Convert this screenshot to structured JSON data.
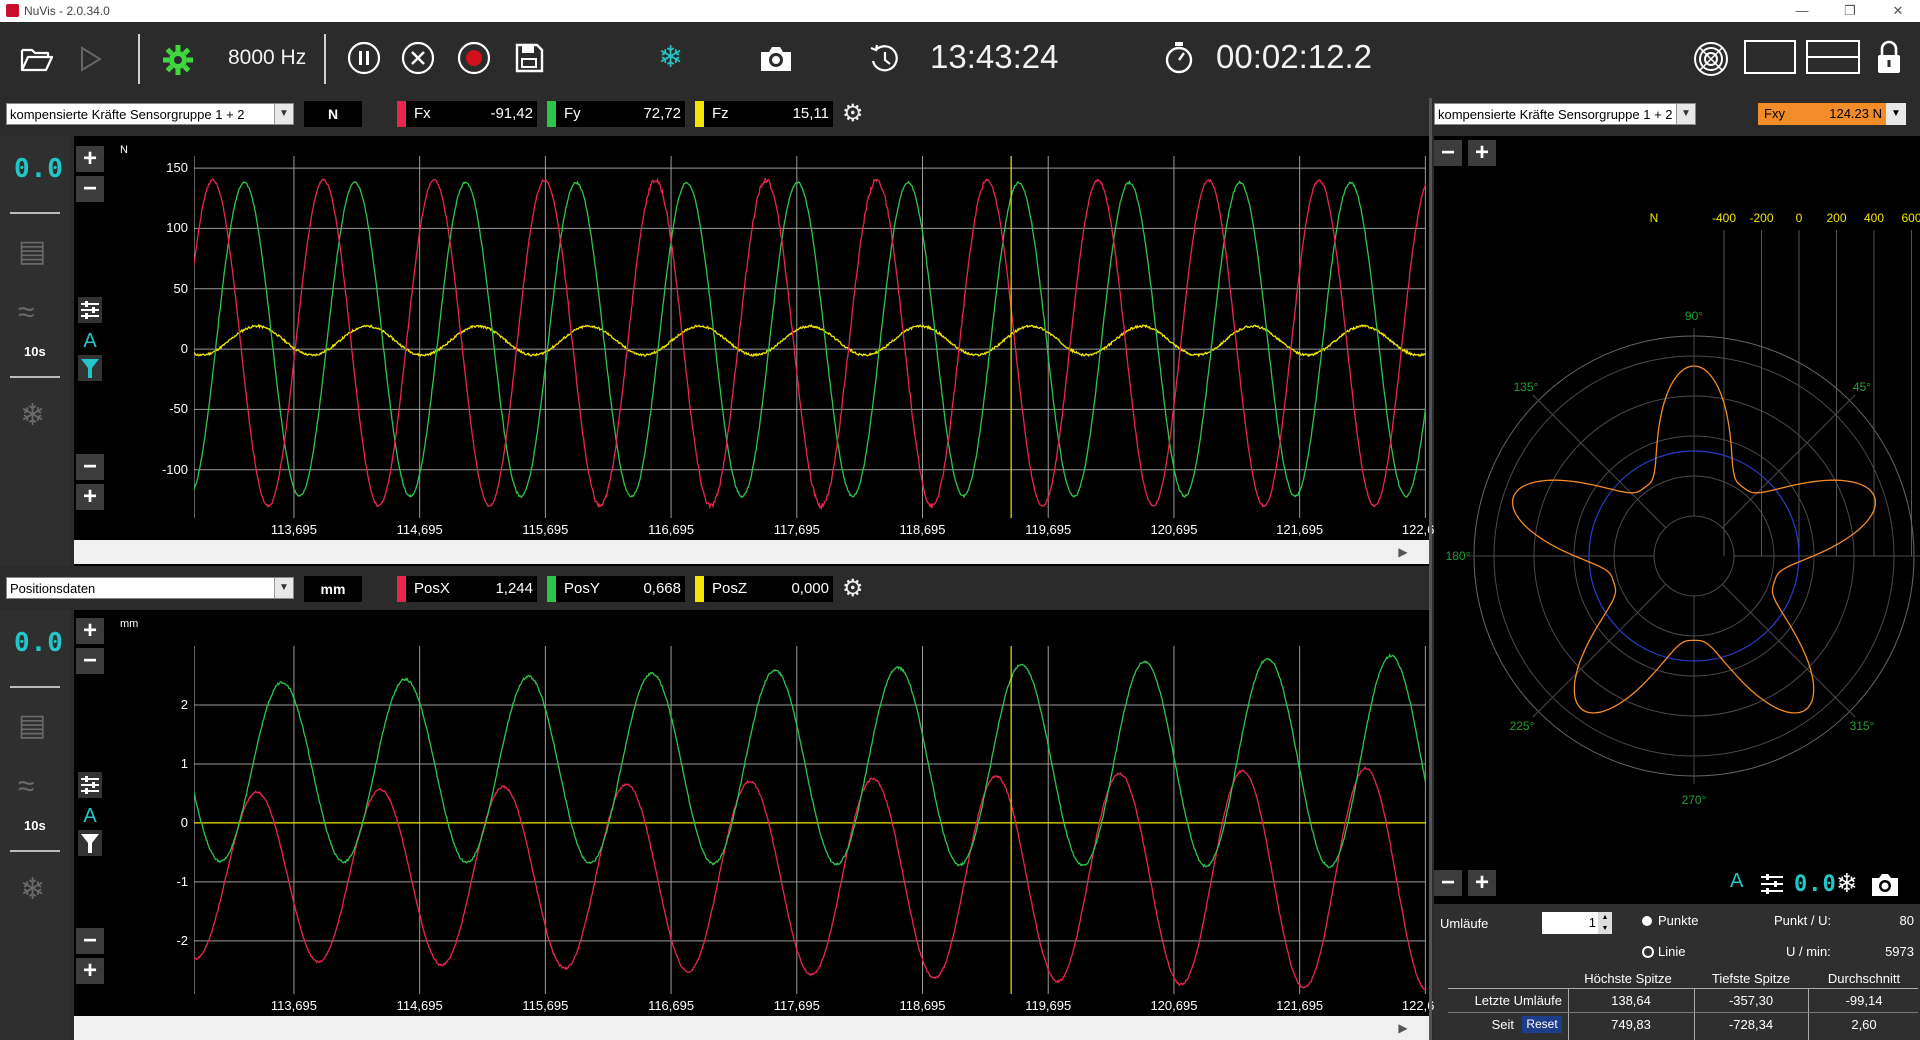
{
  "app": {
    "title": "NuVis - 2.0.34.0"
  },
  "toolbar": {
    "frequency": "8000 Hz",
    "clock": "13:43:24",
    "elapsed": "00:02:12.2"
  },
  "colors": {
    "fx": "#e8254f",
    "fy": "#2ec44a",
    "fz": "#f2e600",
    "fxy": "#f28c28",
    "accent": "#23c6c8"
  },
  "panel_top": {
    "source": "kompensierte Kräfte Sensorgruppe 1 + 2",
    "unit": "N",
    "axis_unit": "N",
    "channels": [
      {
        "name": "Fx",
        "value": "-91,42"
      },
      {
        "name": "Fy",
        "value": "72,72"
      },
      {
        "name": "Fz",
        "value": "15,11"
      }
    ],
    "led": "0.0",
    "interval": "10s",
    "yticks": [
      "150",
      "100",
      "50",
      "0",
      "-50",
      "-100"
    ],
    "xticks": [
      "113,695",
      "114,695",
      "115,695",
      "116,695",
      "117,695",
      "118,695",
      "119,695",
      "120,695",
      "121,695",
      "122,695"
    ],
    "auto_label": "A"
  },
  "panel_bottom": {
    "source": "Positionsdaten",
    "unit": "mm",
    "axis_unit": "mm",
    "channels": [
      {
        "name": "PosX",
        "value": "1,244"
      },
      {
        "name": "PosY",
        "value": "0,668"
      },
      {
        "name": "PosZ",
        "value": "0,000"
      }
    ],
    "led": "0.0",
    "interval": "10s",
    "yticks": [
      "2",
      "1",
      "0",
      "-1",
      "-2"
    ],
    "xticks": [
      "113,695",
      "114,695",
      "115,695",
      "116,695",
      "117,695",
      "118,695",
      "119,695",
      "120,695",
      "121,695",
      "122,695"
    ],
    "auto_label": "A"
  },
  "polar": {
    "source": "kompensierte Kräfte Sensorgruppe 1 + 2",
    "channel": "Fxy",
    "channel_value": "124.23 N",
    "unit": "N",
    "scale_labels": [
      "-400",
      "-200",
      "0",
      "200",
      "400",
      "600"
    ],
    "angles": [
      "90°",
      "45°",
      "135°",
      "180°",
      "225°",
      "270°",
      "315°"
    ],
    "auto_label": "A",
    "led": "0.0",
    "umlaeufe_label": "Umläufe",
    "umlaeufe_value": "1",
    "mode_points": "Punkte",
    "mode_line": "Linie",
    "punkt_per_u_label": "Punkt / U:",
    "punkt_per_u_value": "80",
    "rpm_label": "U / min:",
    "rpm_value": "5973",
    "table": {
      "headers": [
        "Höchste Spitze",
        "Tiefste Spitze",
        "Durchschnitt"
      ],
      "rows": [
        {
          "label": "Letzte Umläufe",
          "values": [
            "138,64",
            "-357,30",
            "-99,14"
          ]
        },
        {
          "label": "Seit",
          "values": [
            "749,83",
            "-728,34",
            "2,60"
          ]
        }
      ],
      "reset_label": "Reset"
    }
  },
  "chart_data": [
    {
      "type": "line",
      "title": "",
      "xlabel": "",
      "ylabel": "N",
      "xlim": [
        112.9,
        122.7
      ],
      "ylim": [
        -140,
        160
      ],
      "series": [
        {
          "name": "Fx",
          "model": "sine",
          "amplitude": 135,
          "offset": 5,
          "period_s": 0.88,
          "x_first_peak": 113.05,
          "noise": "higher near 116-119"
        },
        {
          "name": "Fy",
          "model": "sine",
          "amplitude": 130,
          "offset": 8,
          "period_s": 0.88,
          "x_first_peak": 113.3
        },
        {
          "name": "Fz",
          "model": "sine",
          "amplitude": 12,
          "offset": 7,
          "period_s": 0.88,
          "x_first_peak": 113.4
        }
      ],
      "cursor_x": 119.4
    },
    {
      "type": "line",
      "title": "",
      "xlabel": "",
      "ylabel": "mm",
      "xlim": [
        112.9,
        122.7
      ],
      "ylim": [
        -2.9,
        3.0
      ],
      "series": [
        {
          "name": "PosY",
          "model": "sine",
          "amplitude": 1.5,
          "offset": 0.85,
          "amplitude_end": 1.8,
          "offset_end": 1.05,
          "period_s": 0.98,
          "x_first_peak": 113.6
        },
        {
          "name": "PosX",
          "model": "sine",
          "amplitude": 1.4,
          "offset": -0.9,
          "amplitude_end": 1.9,
          "offset_end": -0.95,
          "period_s": 0.98,
          "x_first_peak": 113.4
        },
        {
          "name": "PosZ",
          "model": "constant",
          "value": 0
        }
      ],
      "cursor_x": 119.4
    },
    {
      "type": "polar",
      "series": [
        {
          "name": "Fxy",
          "model": "five-lobed rosette",
          "lobes": 5,
          "r_outer": 360,
          "r_inner": 160
        }
      ],
      "reference_circle": 0
    }
  ]
}
